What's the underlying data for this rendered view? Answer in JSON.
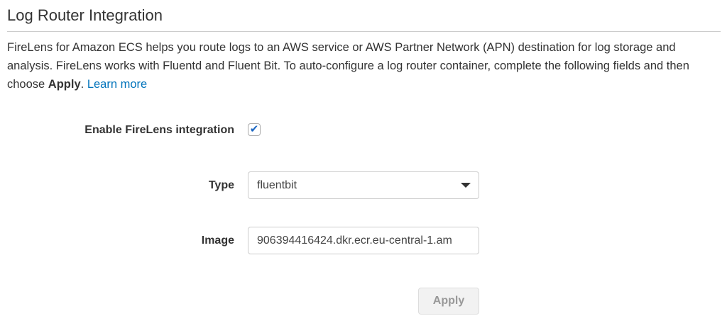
{
  "title": "Log Router Integration",
  "description": {
    "part1": "FireLens for Amazon ECS helps you route logs to an AWS service or AWS Partner Network (APN) destination for log storage and analysis. FireLens works with Fluentd and Fluent Bit. To auto-configure a log router container, complete the following fields and then choose ",
    "bold": "Apply",
    "part2": ". ",
    "link": "Learn more"
  },
  "form": {
    "enable_label": "Enable FireLens integration",
    "enable_checked": true,
    "type_label": "Type",
    "type_value": "fluentbit",
    "image_label": "Image",
    "image_value": "906394416424.dkr.ecr.eu-central-1.am",
    "apply_label": "Apply"
  },
  "colors": {
    "link": "#0073bb",
    "check": "#1a66c2"
  }
}
